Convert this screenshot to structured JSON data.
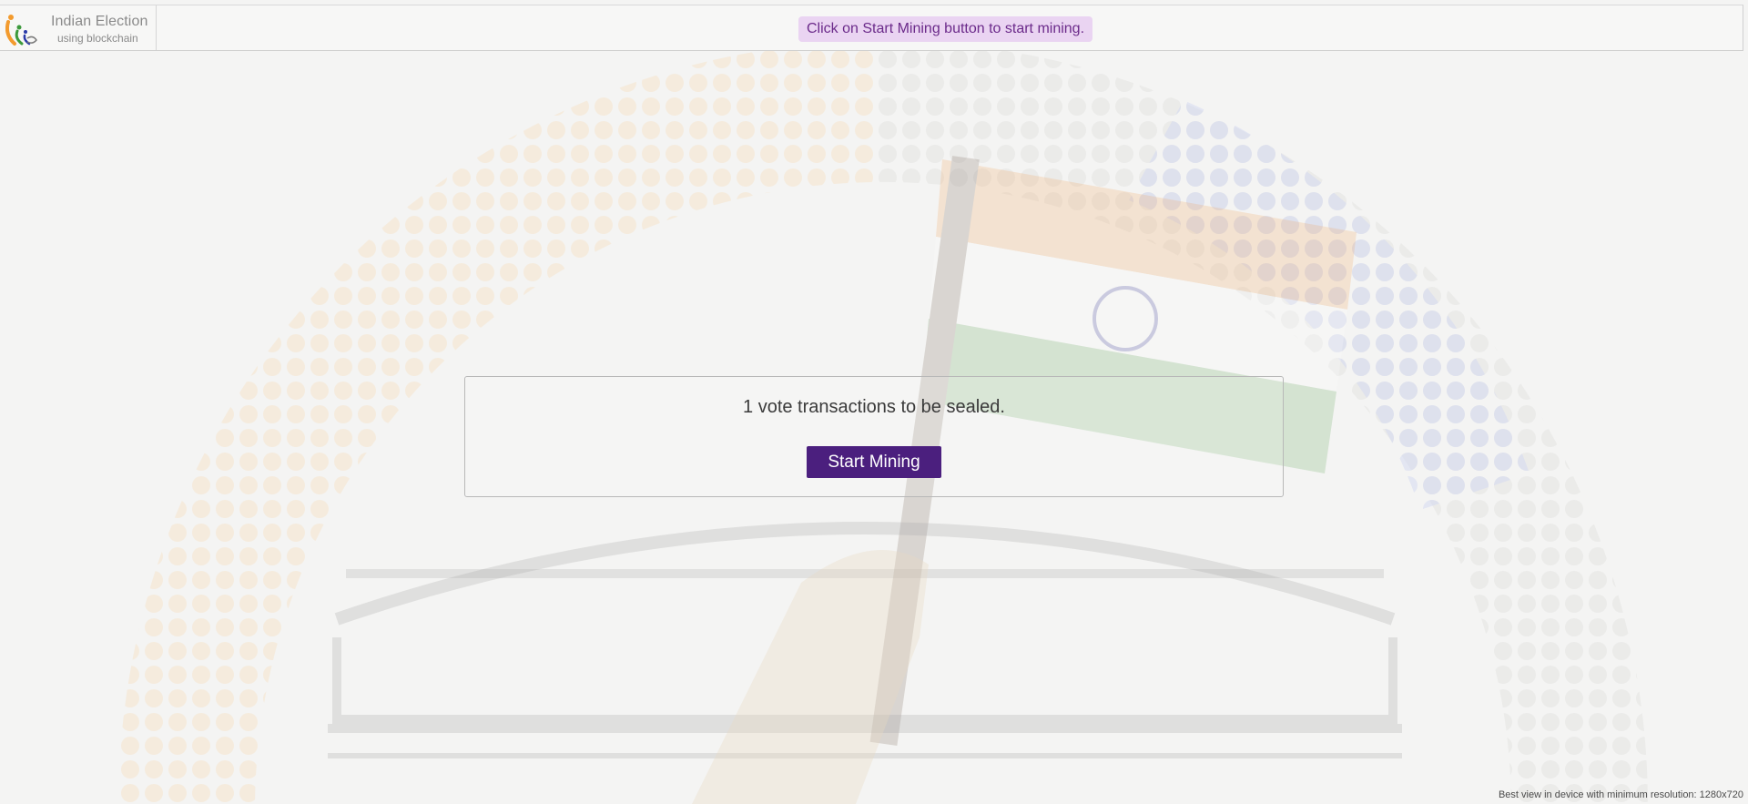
{
  "header": {
    "brand_title": "Indian Election",
    "brand_subtitle": "using blockchain",
    "notice": "Click on Start Mining button to start mining."
  },
  "main": {
    "pending_message": "1 vote transactions to be sealed.",
    "start_button_label": "Start Mining"
  },
  "footer": {
    "resolution_note": "Best view in device with minimum resolution: 1280x720"
  },
  "icons": {
    "logo": "election-voters-logo-icon"
  },
  "colors": {
    "accent": "#4b1f7e",
    "notice_bg": "#ead4f2",
    "notice_text": "#6b2a8a",
    "saffron": "#f39b2e",
    "green": "#3c9a3c",
    "navy": "#2a3aa8"
  }
}
